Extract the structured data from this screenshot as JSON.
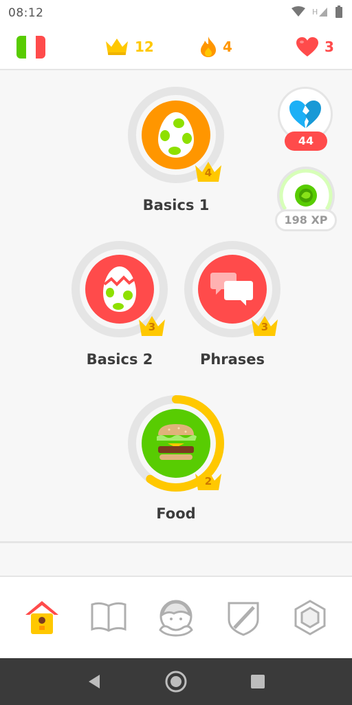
{
  "status_bar": {
    "time": "08:12"
  },
  "header": {
    "language_flag": "italy-flag",
    "crowns": "12",
    "streak": "4",
    "hearts": "3",
    "colors": {
      "crown": "#ffc800",
      "streak": "#ff9600",
      "heart": "#ff4b4b"
    }
  },
  "skills": [
    {
      "name": "Basics 1",
      "crown_level": "4",
      "icon": "egg-icon",
      "color": "#ff9600"
    },
    {
      "name": "Basics 2",
      "crown_level": "3",
      "icon": "cracked-egg-icon",
      "color": "#ff4b4b"
    },
    {
      "name": "Phrases",
      "crown_level": "3",
      "icon": "speech-bubbles-icon",
      "color": "#ff4b4b"
    },
    {
      "name": "Food",
      "crown_level": "2",
      "icon": "burger-icon",
      "color": "#58cc02",
      "progress": 0.6
    }
  ],
  "side_widgets": {
    "broken_heart_count": "44",
    "xp": "198 XP"
  },
  "bottom_nav": [
    "home-icon",
    "stories-book-icon",
    "profile-icon",
    "league-shield-icon",
    "shop-gem-icon"
  ],
  "android_nav": [
    "back-icon",
    "home-circle-icon",
    "recents-square-icon"
  ]
}
